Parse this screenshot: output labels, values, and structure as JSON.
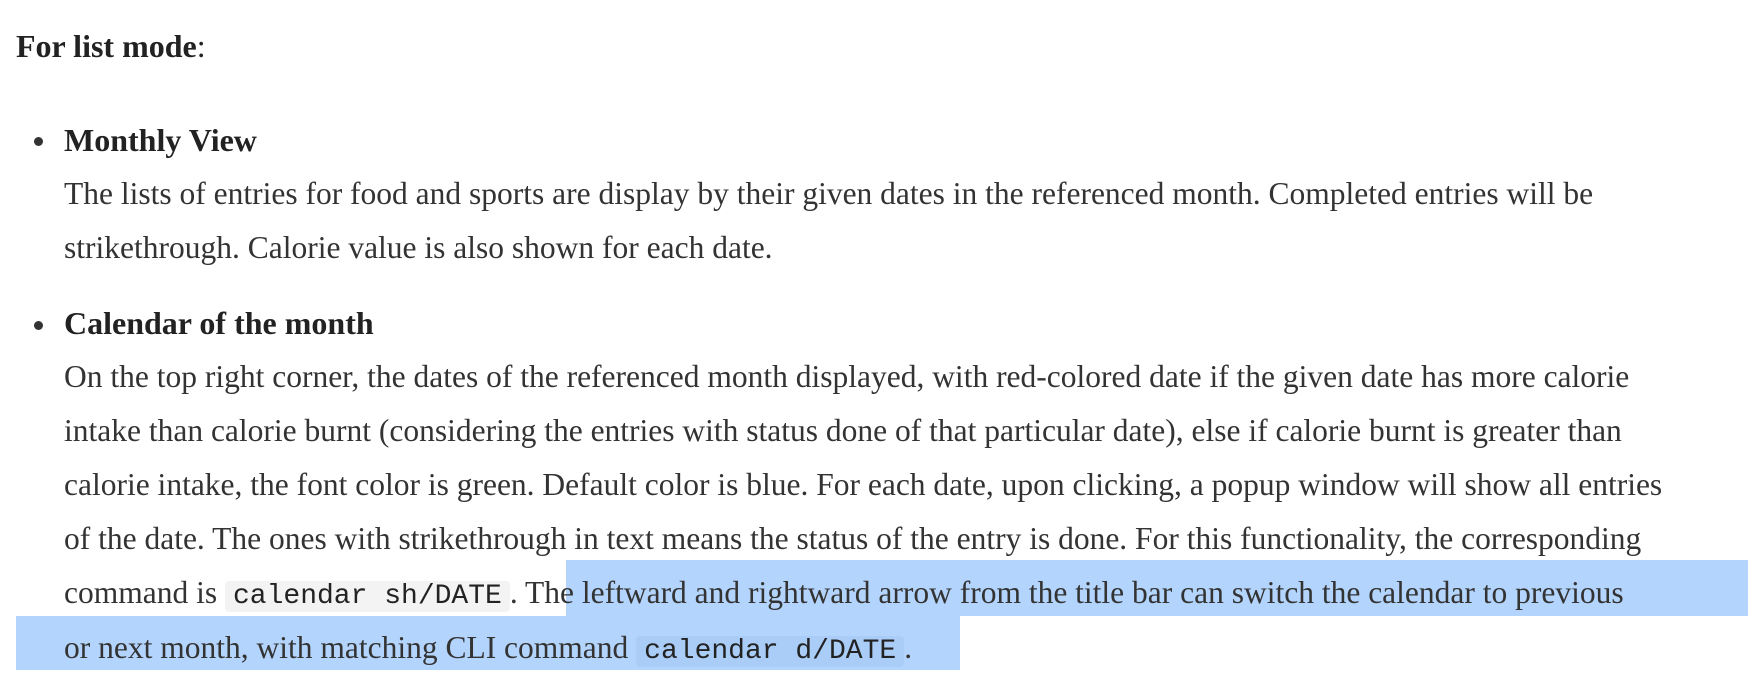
{
  "heading": {
    "bold": "For list mode",
    "suffix": ":"
  },
  "items": [
    {
      "title": "Monthly View",
      "lines": [
        "The lists of entries for food and sports are display by their given dates in the referenced month. Completed entries will be",
        "strikethrough. Calorie value is also shown for each date."
      ]
    },
    {
      "title": "Calendar of the month",
      "lines": [
        "On the top right corner, the dates of the referenced month displayed, with red-colored date if the given date has more calorie",
        "intake than calorie burnt (considering the entries with status done of that particular date), else if calorie burnt is greater than",
        "calorie intake, the font color is green. Default color is blue. For each date, upon clicking, a popup window will show all entries",
        "of the date. The ones with strikethrough in text means the status of the entry is done. For this functionality, the corresponding"
      ],
      "line5": {
        "pre": "command is ",
        "code": "calendar sh/DATE",
        "mid": ". ",
        "selected": "The leftward and rightward arrow from the title bar can switch the calendar to previous"
      },
      "line6": {
        "selected_pre": "or next month, with matching CLI command ",
        "selected_code": "calendar d/DATE",
        "post": "."
      }
    }
  ]
}
